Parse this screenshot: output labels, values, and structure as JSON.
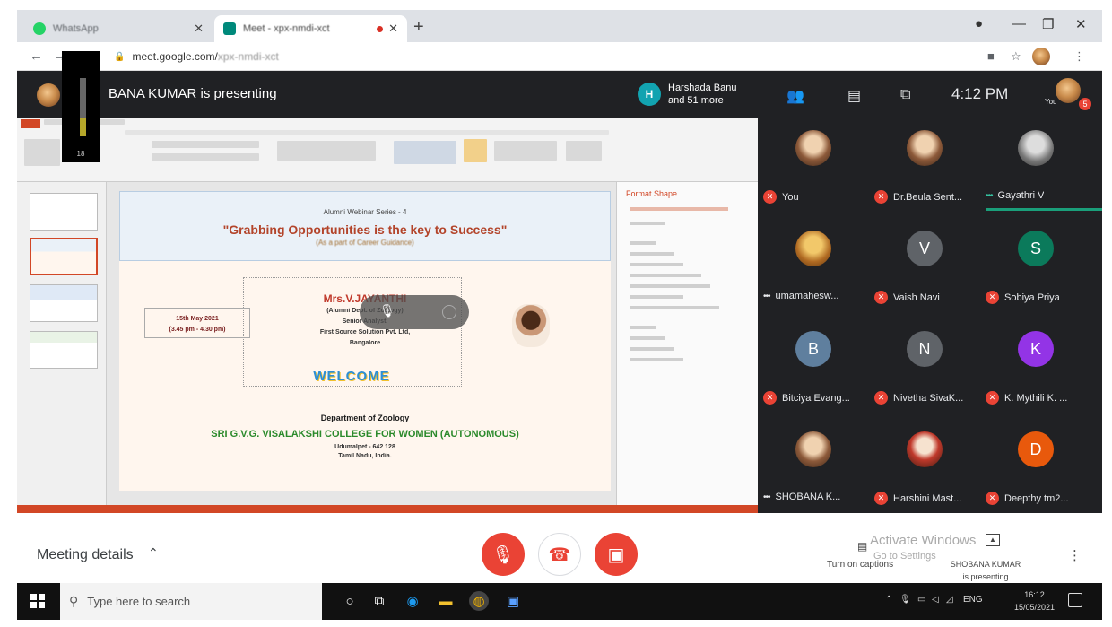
{
  "browser": {
    "tabs": [
      {
        "title": "WhatsApp",
        "icon": "whatsapp-icon",
        "color": "#25d366"
      },
      {
        "title": "Meet - xpx-nmdi-xct",
        "icon": "meet-icon",
        "color": "#00897b"
      }
    ],
    "url": "meet.google.com/",
    "url_suffix": "xpx-nmdi-xct"
  },
  "meet": {
    "presenter_text": "BANA KUMAR is presenting",
    "mic_level_label": "18",
    "participants_badge_letter": "H",
    "participants_summary_line1": "Harshada Banu",
    "participants_summary_line2": "and 51 more",
    "clock": "4:12 PM",
    "you_label": "You",
    "header_badge_count": "5"
  },
  "slide": {
    "series": "Alumni Webinar Series - 4",
    "headline": "\"Grabbing Opportunities is the key to Success\"",
    "subheading": "(As a part of Career Guidance)",
    "speaker": "Mrs.V.JAYANTHI",
    "speaker_detail_1": "(Alumni Dept. of Zoology)",
    "speaker_detail_2": "Senior Analyst,",
    "speaker_detail_3": "First Source Solution Pvt. Ltd,",
    "speaker_detail_4": "Bangalore",
    "date_line": "15th May 2021",
    "time_line": "(3.45 pm - 4.30 pm)",
    "welcome": "WELCOME",
    "department": "Department of Zoology",
    "college": "SRI G.V.G. VISALAKSHI COLLEGE FOR WOMEN (AUTONOMOUS)",
    "address_1": "Udumalpet - 642 128",
    "address_2": "Tamil Nadu, India.",
    "pane_title": "Format Shape"
  },
  "participants": [
    {
      "name": "You",
      "type": "photo",
      "muted": true
    },
    {
      "name": "Dr.Beula Sent...",
      "type": "photo",
      "muted": true
    },
    {
      "name": "Gayathri V",
      "type": "photo",
      "muted": false,
      "speaking": true
    },
    {
      "name": "umamahesw...",
      "type": "photo",
      "muted": false
    },
    {
      "name": "Vaish Navi",
      "type": "letter",
      "letter": "V",
      "color": "#5f6368",
      "muted": true
    },
    {
      "name": "Sobiya Priya",
      "type": "letter",
      "letter": "S",
      "color": "#0b7a5b",
      "muted": true
    },
    {
      "name": "Bitciya Evang...",
      "type": "letter",
      "letter": "B",
      "color": "#5f7f9e",
      "muted": true
    },
    {
      "name": "Nivetha SivaK...",
      "type": "letter",
      "letter": "N",
      "color": "#5f6368",
      "muted": true
    },
    {
      "name": "K. Mythili K. ...",
      "type": "letter",
      "letter": "K",
      "color": "#9334e6",
      "muted": true
    },
    {
      "name": "SHOBANA K...",
      "type": "photo",
      "muted": false
    },
    {
      "name": "Harshini Mast...",
      "type": "photo",
      "muted": true
    },
    {
      "name": "Deepthy tm2...",
      "type": "letter",
      "letter": "D",
      "color": "#e8590c",
      "muted": true
    }
  ],
  "bottom": {
    "meeting_details": "Meeting details",
    "captions": "Turn on captions",
    "activate_1": "Activate Windows",
    "activate_2": "Go to Settings",
    "presenting_name": "SHOBANA KUMAR",
    "presenting_text": "is presenting"
  },
  "taskbar": {
    "search_placeholder": "Type here to search",
    "lang": "ENG",
    "time": "16:12",
    "date": "15/05/2021"
  },
  "colors": {
    "danger": "#ea4335",
    "meet_bg": "#202124",
    "ppt_accent": "#d24726"
  }
}
